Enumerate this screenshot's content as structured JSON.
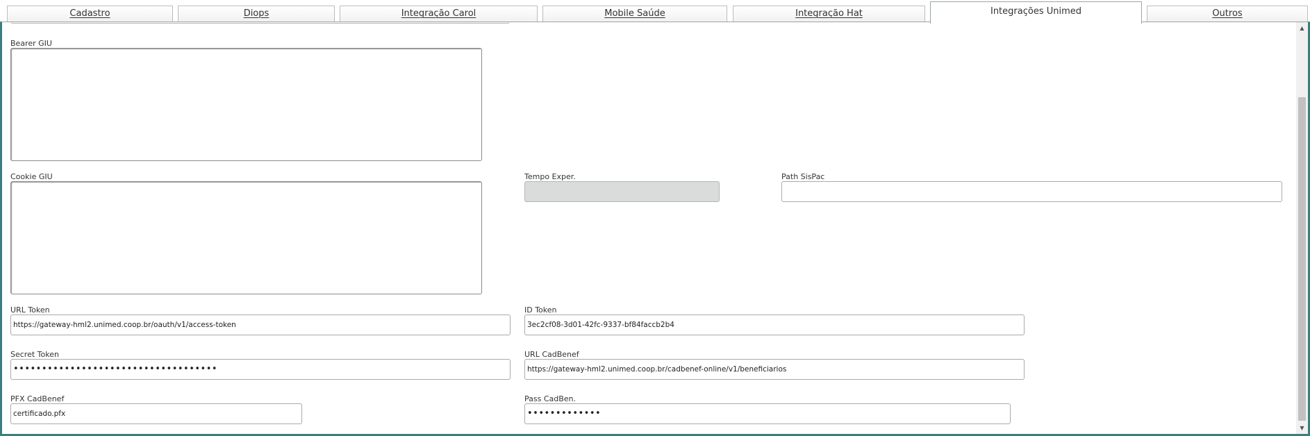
{
  "tabs": [
    {
      "label": "Cadastro"
    },
    {
      "label": "Diops"
    },
    {
      "label": "Integração Carol"
    },
    {
      "label": "Mobile Saúde"
    },
    {
      "label": "Integração Hat"
    },
    {
      "label": "Integrações Unimed"
    },
    {
      "label": "Outros"
    }
  ],
  "active_tab": "Integrações Unimed",
  "form": {
    "bearer_giu": {
      "label": "Bearer GIU",
      "value": ""
    },
    "cookie_giu": {
      "label": "Cookie GIU",
      "value": ""
    },
    "tempo_exper": {
      "label": "Tempo Exper.",
      "value": ""
    },
    "path_sispac": {
      "label": "Path SisPac",
      "value": ""
    },
    "url_token": {
      "label": "URL Token",
      "value": "https://gateway-hml2.unimed.coop.br/oauth/v1/access-token"
    },
    "id_token": {
      "label": "ID Token",
      "value": "3ec2cf08-3d01-42fc-9337-bf84faccb2b4"
    },
    "secret_token": {
      "label": "Secret Token",
      "value": "••••••••••••••••••••••••••••••••••••"
    },
    "url_cadbenef": {
      "label": "URL CadBenef",
      "value": "https://gateway-hml2.unimed.coop.br/cadbenef-online/v1/beneficiarios"
    },
    "pfx_cadbenef": {
      "label": "PFX CadBenef",
      "value": "certificado.pfx"
    },
    "pass_cadben": {
      "label": "Pass CadBen.",
      "value": "•••••••••••••"
    }
  },
  "scrollbar": {
    "up_icon": "arrow-up-icon",
    "down_icon": "arrow-down-icon"
  }
}
